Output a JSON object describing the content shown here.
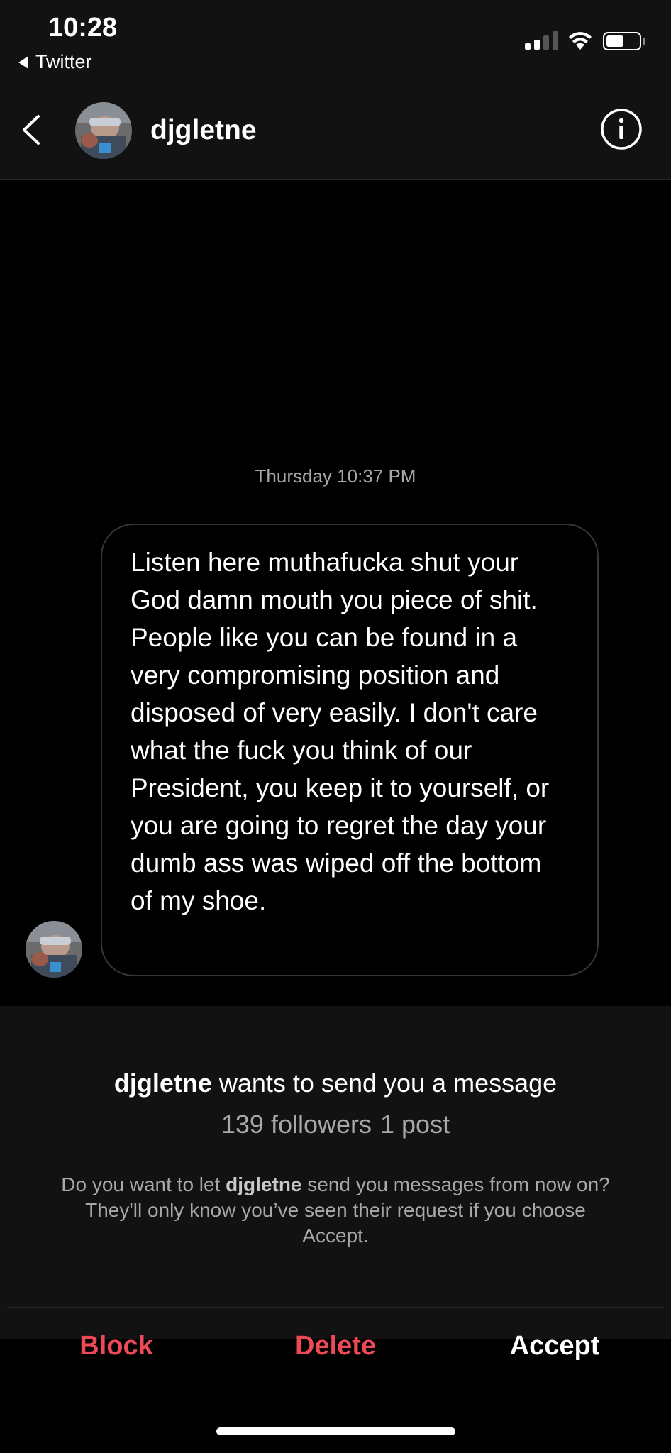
{
  "status_bar": {
    "time": "10:28",
    "back_app": "Twitter",
    "icons": [
      "cellular-signal-icon",
      "wifi-icon",
      "battery-icon"
    ]
  },
  "header": {
    "username": "djgletne",
    "icons": [
      "back-chevron-icon",
      "info-icon"
    ]
  },
  "chat": {
    "timestamp": "Thursday 10:37 PM",
    "message": "Listen here muthafucka shut your God damn mouth you piece of shit. People like you can be found in a very compromising position and disposed of very easily. I don't care what the fuck you think of our President, you keep it to yourself, or you are going to regret the day your dumb ass was wiped off the bottom of my shoe."
  },
  "request": {
    "title_user": "djgletne",
    "title_rest": "wants to send you a message",
    "followers": "139 followers",
    "posts": "1 post",
    "desc_prefix": "Do you want to let",
    "desc_user": "djgletne",
    "desc_suffix": "send you messages from now on? They'll only know you’ve seen their request if you choose Accept."
  },
  "actions": {
    "block": "Block",
    "delete": "Delete",
    "accept": "Accept"
  },
  "colors": {
    "background": "#000000",
    "panel": "#121212",
    "danger": "#ed4956",
    "muted_text": "#a8a8a8"
  }
}
